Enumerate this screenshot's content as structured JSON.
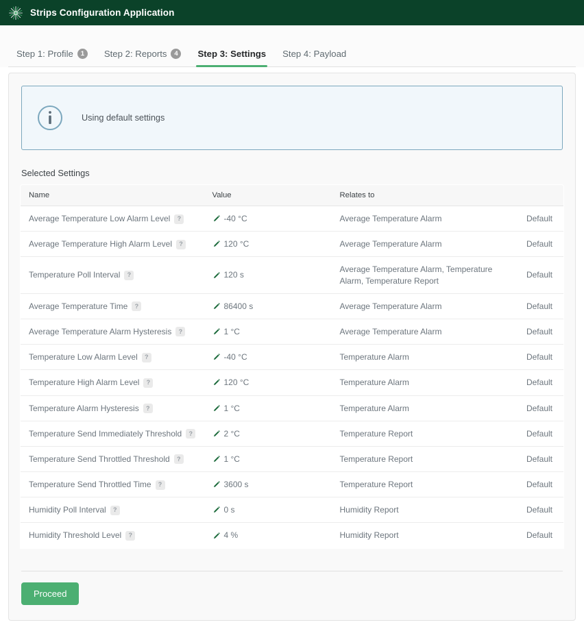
{
  "app": {
    "title": "Strips Configuration Application",
    "logo_icon": "sunburst-logo-icon",
    "header_bg": "#0b4229"
  },
  "tabs": [
    {
      "label": "Step 1: Profile",
      "badge": "1",
      "active": false
    },
    {
      "label": "Step 2: Reports",
      "badge": "4",
      "active": false
    },
    {
      "label": "Step 3: Settings",
      "badge": "",
      "active": true
    },
    {
      "label": "Step 4: Payload",
      "badge": "",
      "active": false
    }
  ],
  "info_banner": {
    "icon": "info-circle-icon",
    "message": "Using default settings",
    "border_color": "#7ba7bd",
    "background_color": "#f1f7fb"
  },
  "settings_section": {
    "title": "Selected Settings",
    "columns": [
      "Name",
      "Value",
      "Relates to",
      ""
    ],
    "rows": [
      {
        "name": "Average Temperature Low Alarm Level",
        "help": "?",
        "edit_icon": "pencil-icon",
        "value": "-40 °C",
        "relates_to": "Average Temperature Alarm",
        "source": "Default"
      },
      {
        "name": "Average Temperature High Alarm Level",
        "help": "?",
        "edit_icon": "pencil-icon",
        "value": "120 °C",
        "relates_to": "Average Temperature Alarm",
        "source": "Default"
      },
      {
        "name": "Temperature Poll Interval",
        "help": "?",
        "edit_icon": "pencil-icon",
        "value": "120 s",
        "relates_to": "Average Temperature Alarm, Temperature Alarm, Temperature Report",
        "source": "Default"
      },
      {
        "name": "Average Temperature Time",
        "help": "?",
        "edit_icon": "pencil-icon",
        "value": "86400 s",
        "relates_to": "Average Temperature Alarm",
        "source": "Default"
      },
      {
        "name": "Average Temperature Alarm Hysteresis",
        "help": "?",
        "edit_icon": "pencil-icon",
        "value": "1 °C",
        "relates_to": "Average Temperature Alarm",
        "source": "Default"
      },
      {
        "name": "Temperature Low Alarm Level",
        "help": "?",
        "edit_icon": "pencil-icon",
        "value": "-40 °C",
        "relates_to": "Temperature Alarm",
        "source": "Default"
      },
      {
        "name": "Temperature High Alarm Level",
        "help": "?",
        "edit_icon": "pencil-icon",
        "value": "120 °C",
        "relates_to": "Temperature Alarm",
        "source": "Default"
      },
      {
        "name": "Temperature Alarm Hysteresis",
        "help": "?",
        "edit_icon": "pencil-icon",
        "value": "1 °C",
        "relates_to": "Temperature Alarm",
        "source": "Default"
      },
      {
        "name": "Temperature Send Immediately Threshold",
        "help": "?",
        "edit_icon": "pencil-icon",
        "value": "2 °C",
        "relates_to": "Temperature Report",
        "source": "Default"
      },
      {
        "name": "Temperature Send Throttled Threshold",
        "help": "?",
        "edit_icon": "pencil-icon",
        "value": "1 °C",
        "relates_to": "Temperature Report",
        "source": "Default"
      },
      {
        "name": "Temperature Send Throttled Time",
        "help": "?",
        "edit_icon": "pencil-icon",
        "value": "3600 s",
        "relates_to": "Temperature Report",
        "source": "Default"
      },
      {
        "name": "Humidity Poll Interval",
        "help": "?",
        "edit_icon": "pencil-icon",
        "value": "0 s",
        "relates_to": "Humidity Report",
        "source": "Default"
      },
      {
        "name": "Humidity Threshold Level",
        "help": "?",
        "edit_icon": "pencil-icon",
        "value": "4 %",
        "relates_to": "Humidity Report",
        "source": "Default"
      }
    ]
  },
  "footer": {
    "proceed_label": "Proceed",
    "proceed_color": "#4caf72"
  }
}
